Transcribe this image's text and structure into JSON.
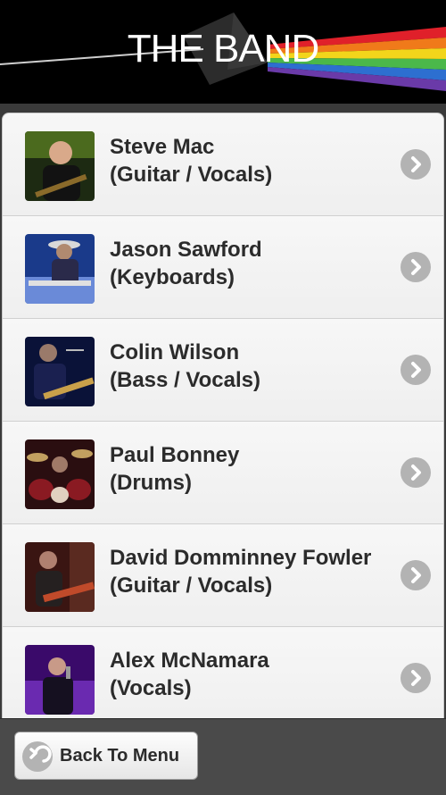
{
  "header": {
    "title": "THE BAND"
  },
  "members": [
    {
      "name": "Steve Mac",
      "role": "(Guitar / Vocals)"
    },
    {
      "name": "Jason Sawford",
      "role": "(Keyboards)"
    },
    {
      "name": "Colin Wilson",
      "role": "(Bass / Vocals)"
    },
    {
      "name": "Paul Bonney",
      "role": "(Drums)"
    },
    {
      "name": "David Domminney Fowler",
      "role": "(Guitar / Vocals)"
    },
    {
      "name": "Alex McNamara",
      "role": "(Vocals)"
    }
  ],
  "footer": {
    "back_label": "Back To Menu"
  },
  "icons": {
    "row_arrow": "chevron-right-icon",
    "back": "back-arrow-icon"
  },
  "colors": {
    "header_bg": "#000000",
    "list_bg": "#f4f4f4",
    "text": "#2b2b2b",
    "arrow_circle": "#b3b3b3"
  }
}
